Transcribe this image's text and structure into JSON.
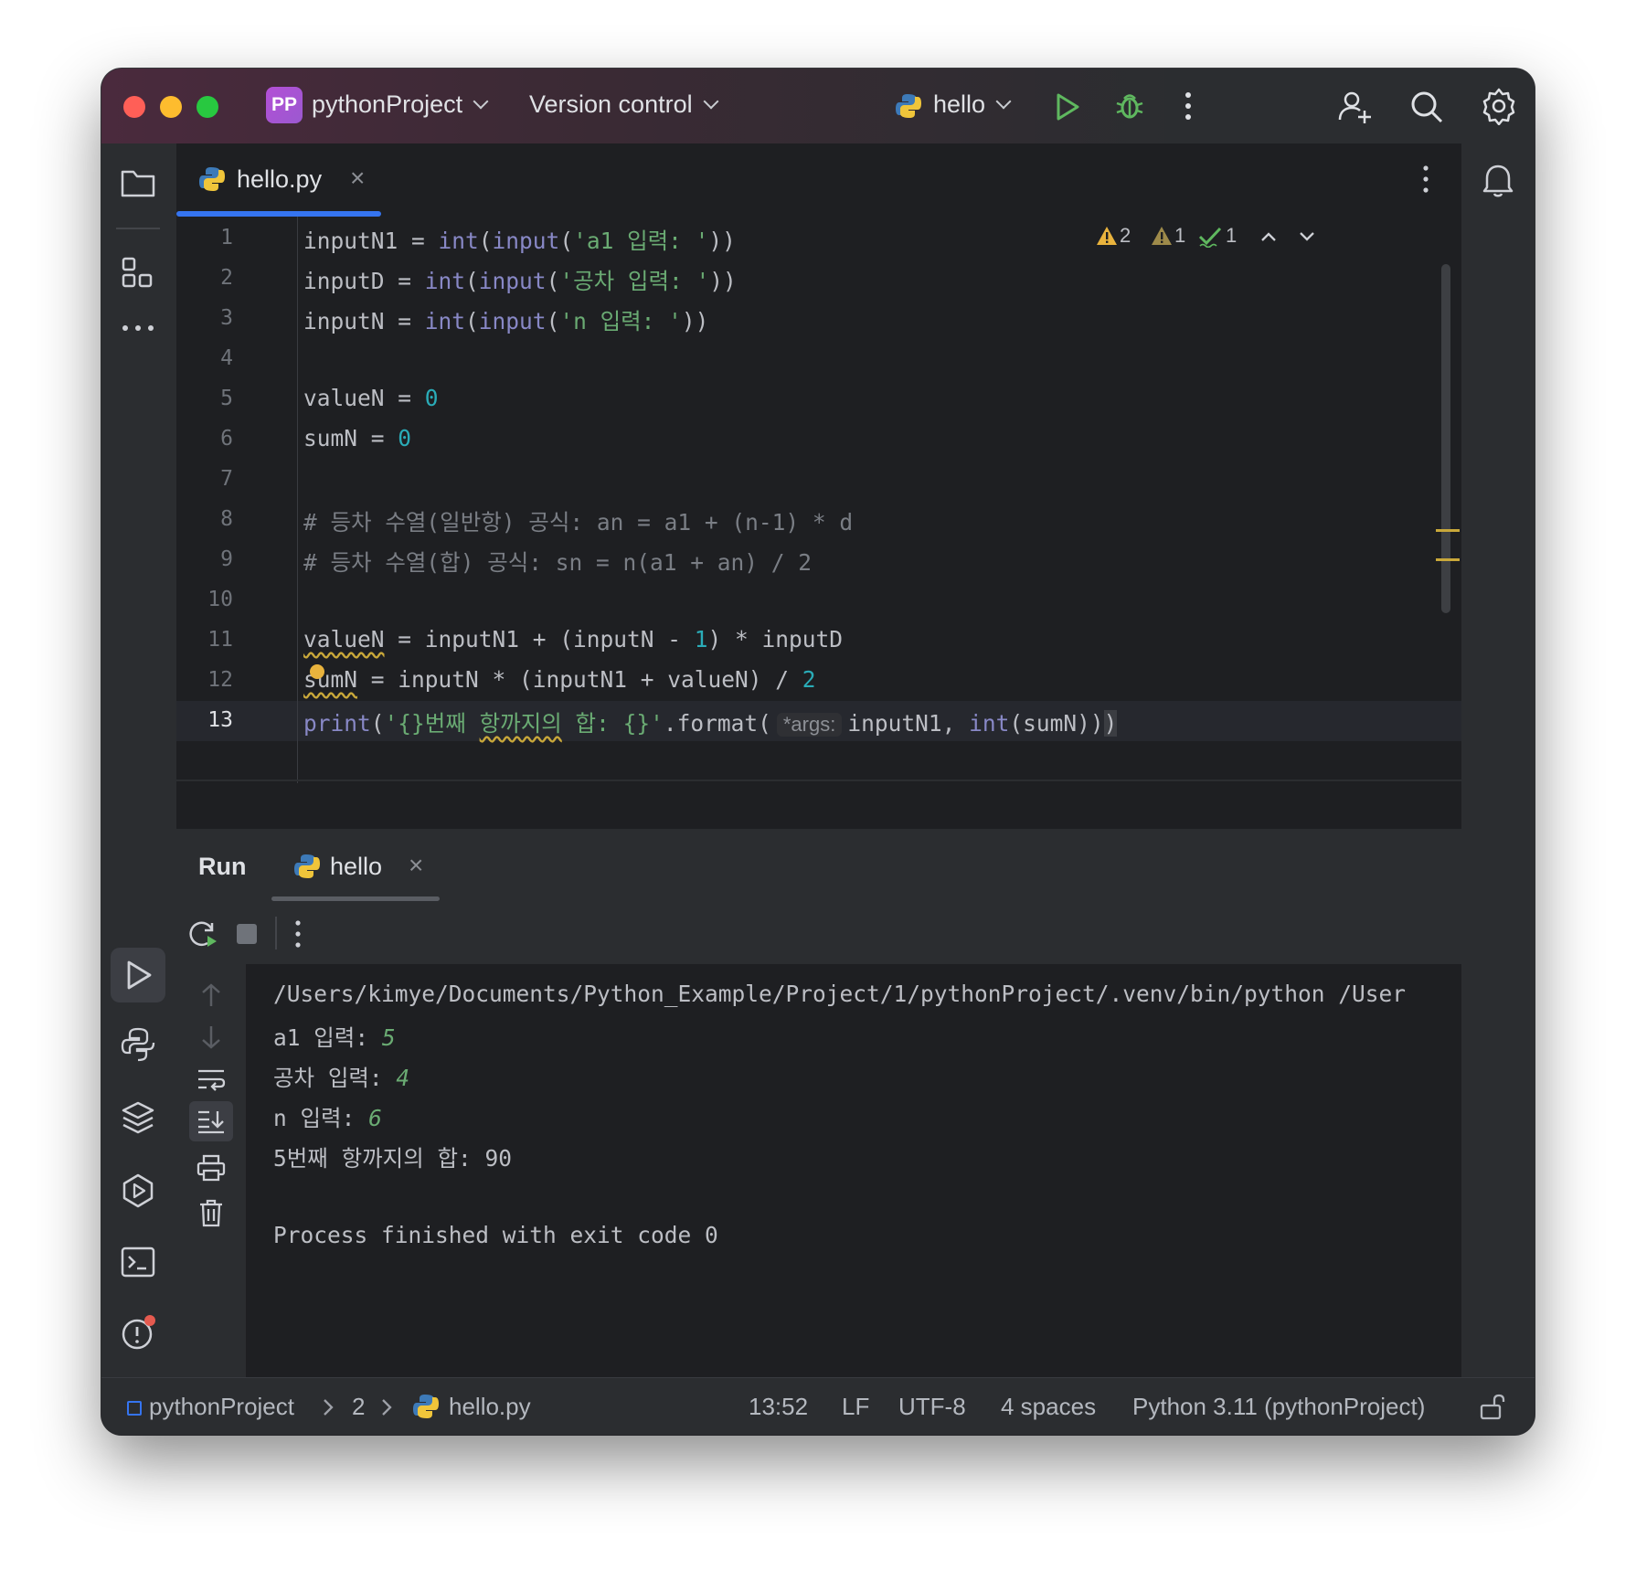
{
  "titlebar": {
    "project_badge": "PP",
    "project_name": "pythonProject",
    "version_control": "Version control",
    "run_config": "hello",
    "icons": [
      "python-icon",
      "run-icon",
      "debug-icon",
      "more-icon",
      "add-user-icon",
      "search-icon",
      "gear-icon"
    ]
  },
  "colors": {
    "close": "#ff5f57",
    "minimize": "#febc2e",
    "maximize": "#28c840",
    "accent": "#3574f0",
    "run_green": "#5fb85f",
    "warning": "#e9b33d"
  },
  "editor": {
    "tab": {
      "label": "hello.py",
      "close": "×"
    },
    "inspections": {
      "warnings": "2",
      "weak_warnings": "1",
      "typos": "1"
    },
    "lines": [
      {
        "n": "1"
      },
      {
        "n": "2"
      },
      {
        "n": "3"
      },
      {
        "n": "4"
      },
      {
        "n": "5"
      },
      {
        "n": "6"
      },
      {
        "n": "7"
      },
      {
        "n": "8"
      },
      {
        "n": "9"
      },
      {
        "n": "10"
      },
      {
        "n": "11"
      },
      {
        "n": "12"
      },
      {
        "n": "13"
      }
    ],
    "code": {
      "l1": {
        "a": "inputN1 = ",
        "b": "int",
        "c": "(",
        "d": "input",
        "e": "(",
        "f": "'a1 입력: '",
        "g": "))"
      },
      "l2": {
        "a": "inputD = ",
        "b": "int",
        "c": "(",
        "d": "input",
        "e": "(",
        "f": "'공차 입력: '",
        "g": "))"
      },
      "l3": {
        "a": "inputN = ",
        "b": "int",
        "c": "(",
        "d": "input",
        "e": "(",
        "f": "'n 입력: '",
        "g": "))"
      },
      "l5": {
        "a": "valueN = ",
        "b": "0"
      },
      "l6": {
        "a": "sumN = ",
        "b": "0"
      },
      "l8": "# 등차 수열(일반항) 공식: an = a1 + (n-1) * d",
      "l9": "# 등차 수열(합) 공식: sn = n(a1 + an) / 2",
      "l11": {
        "a": "valueN",
        "b": " = inputN1 + (inputN - ",
        "c": "1",
        "d": ") * inputD"
      },
      "l12": {
        "a": "sumN",
        "b": " = inputN * (inputN1 + valueN) / ",
        "c": "2"
      },
      "l13": {
        "a": "print",
        "b": "(",
        "c": "'{}번째 ",
        "d": "항까지의",
        "e": " 합: {}'",
        "f": ".format(",
        "hint": "*args:",
        "g": "inputN1, ",
        "h": "int",
        "i": "(sumN))",
        "j": ")"
      }
    }
  },
  "run": {
    "title": "Run",
    "tab": "hello",
    "tab_close": "×",
    "console": {
      "command": "/Users/kimye/Documents/Python_Example/Project/1/pythonProject/.venv/bin/python /User",
      "q1": "a1 입력: ",
      "a1": "5",
      "q2": "공차 입력: ",
      "a2": "4",
      "q3": "n 입력: ",
      "a3": "6",
      "result": "5번째 항까지의 합: 90",
      "exit": "Process finished with exit code 0"
    }
  },
  "statusbar": {
    "project": "pythonProject",
    "folder": "2",
    "file": "hello.py",
    "position": "13:52",
    "line_sep": "LF",
    "encoding": "UTF-8",
    "indent": "4 spaces",
    "interpreter": "Python 3.11 (pythonProject)"
  }
}
